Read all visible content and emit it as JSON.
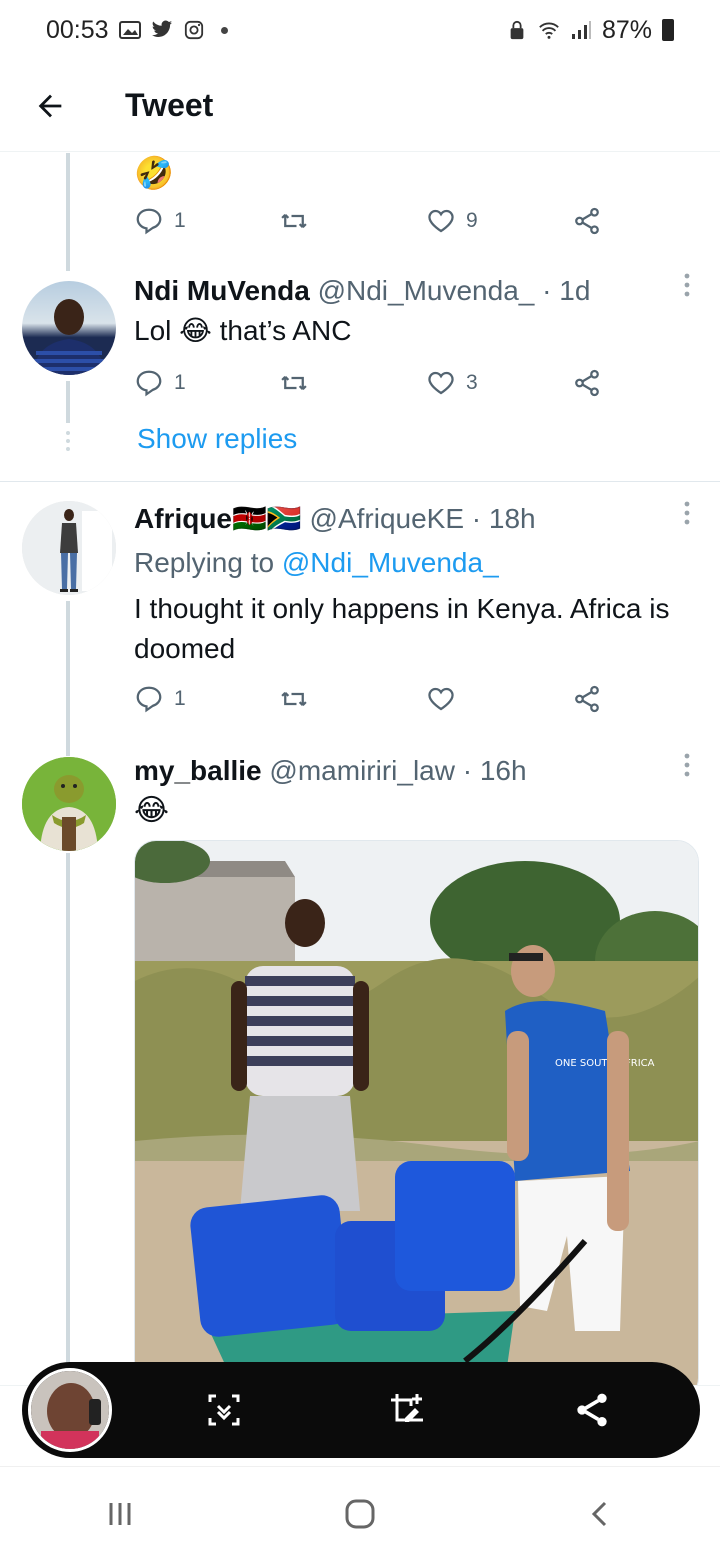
{
  "status_bar": {
    "time": "00:53",
    "battery": "87%"
  },
  "header": {
    "title": "Tweet"
  },
  "top_tweet": {
    "emoji": "🤣",
    "reply_count": "1",
    "like_count": "9"
  },
  "tweet1": {
    "name": "Ndi MuVenda",
    "handle": "@Ndi_Muvenda_",
    "time": "· 1d",
    "text_before": "Lol ",
    "emoji": "😂",
    "text_after": " that’s ANC",
    "reply_count": "1",
    "like_count": "3",
    "show_replies": "Show replies"
  },
  "tweet2": {
    "name": "Afrique",
    "flags": "🇰🇪🇿🇦",
    "handle": "@AfriqueKE",
    "time": "· 18h",
    "replying_prefix": "Replying to ",
    "replying_handle": "@Ndi_Muvenda_",
    "text": "I thought it only happens in Kenya. Africa is doomed",
    "reply_count": "1"
  },
  "tweet3": {
    "name": "my_ballie",
    "handle": "@mamiriri_law",
    "time": "· 16h",
    "emoji": "😂",
    "media_shirt_text": "ONE SOUTH AFRICA"
  },
  "colors": {
    "accent": "#1d9bf0",
    "muted": "#536471",
    "thread": "#cfd9de"
  },
  "icons": [
    "back-arrow-icon",
    "reply-icon",
    "retweet-icon",
    "like-icon",
    "share-icon",
    "more-icon",
    "scroll-capture-icon",
    "crop-edit-icon",
    "share-icon",
    "recent-apps-icon",
    "home-icon",
    "back-icon"
  ]
}
